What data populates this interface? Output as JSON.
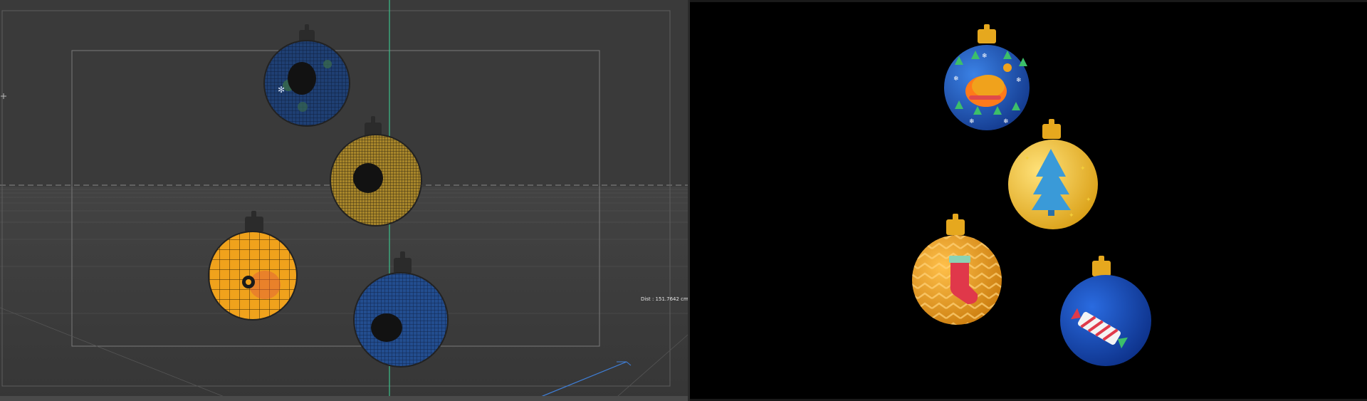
{
  "viewport": {
    "distance_readout": "Dist : 151.7642 cm",
    "background_color": "#3a3a3a",
    "y_axis_color": "#3cc08a",
    "x_axis_color": "#3f7fd8"
  },
  "render": {
    "background_color": "#000000",
    "ornaments": [
      {
        "name": "turkey",
        "ball_color": "#1d5bc4",
        "motif": "turkey"
      },
      {
        "name": "christmas-tree",
        "ball_color": "#f2c12e",
        "motif": "christmas-tree"
      },
      {
        "name": "stocking",
        "ball_color": "#f0a21c",
        "motif": "stocking"
      },
      {
        "name": "candy",
        "ball_color": "#1448b8",
        "motif": "candy"
      }
    ]
  }
}
